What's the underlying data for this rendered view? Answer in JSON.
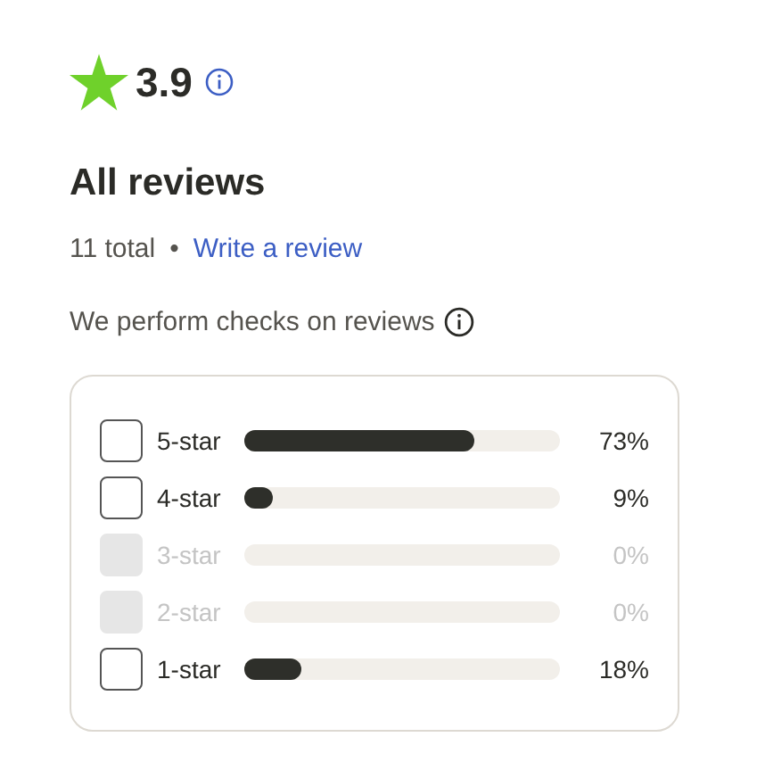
{
  "rating": {
    "value": "3.9"
  },
  "heading": "All reviews",
  "summary": {
    "total": "11 total",
    "separator": "•",
    "link": "Write a review"
  },
  "checks_note": "We perform checks on reviews",
  "filters": [
    {
      "label": "5-star",
      "checked": false,
      "disabled": false,
      "level": 0.73,
      "percent": "73%"
    },
    {
      "label": "4-star",
      "checked": false,
      "disabled": false,
      "level": 0.09,
      "percent": "9%"
    },
    {
      "label": "3-star",
      "checked": false,
      "disabled": true,
      "percent": "0%"
    },
    {
      "label": "2-star",
      "checked": false,
      "disabled": true,
      "percent": "0%"
    },
    {
      "label": "1-star",
      "checked": false,
      "disabled": false,
      "level": 0.18,
      "percent": "18%"
    }
  ]
}
